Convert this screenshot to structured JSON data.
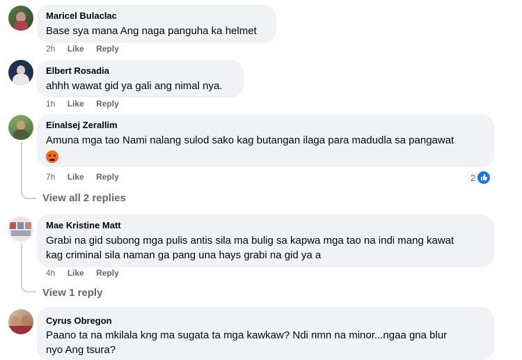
{
  "comments": [
    {
      "name": "Maricel Bulaclac",
      "lines": [
        "Base sya mana Ang naga panguha ka helmet"
      ],
      "time": "2h",
      "like": "Like",
      "reply": "Reply"
    },
    {
      "name": "Elbert Rosadia",
      "lines": [
        "ahhh wawat gid ya gali ang nimal nya."
      ],
      "time": "1h",
      "like": "Like",
      "reply": "Reply"
    },
    {
      "name": "Einalsej Zerallim",
      "lines": [
        "Amuna mga tao Nami nalang sulod sako kag butangan ilaga para madudla sa pangawat"
      ],
      "emoji": "angry-face-emoji",
      "time": "7h",
      "like": "Like",
      "reply": "Reply",
      "reaction_count": "2",
      "replies_link": "View all 2 replies"
    },
    {
      "name": "Mae Kristine Matt",
      "lines": [
        "Grabi na gid subong mga pulis antis sila ma bulig sa kapwa mga tao na indi mang kawat",
        "kag criminal sila naman ga pang una hays grabi na gid ya a"
      ],
      "time": "4h",
      "like": "Like",
      "reply": "Reply",
      "replies_link": "View 1 reply"
    },
    {
      "name": "Cyrus Obregon",
      "lines": [
        "Paano ta na mkilala kng ma sugata ta mga kawkaw? Ndi nmn na minor...ngaa gna blur",
        "nyo Ang tsura?"
      ]
    }
  ],
  "colors": {
    "bubble": "#f0f2f5",
    "meta": "#65676b",
    "like_blue": "#1877f2"
  }
}
